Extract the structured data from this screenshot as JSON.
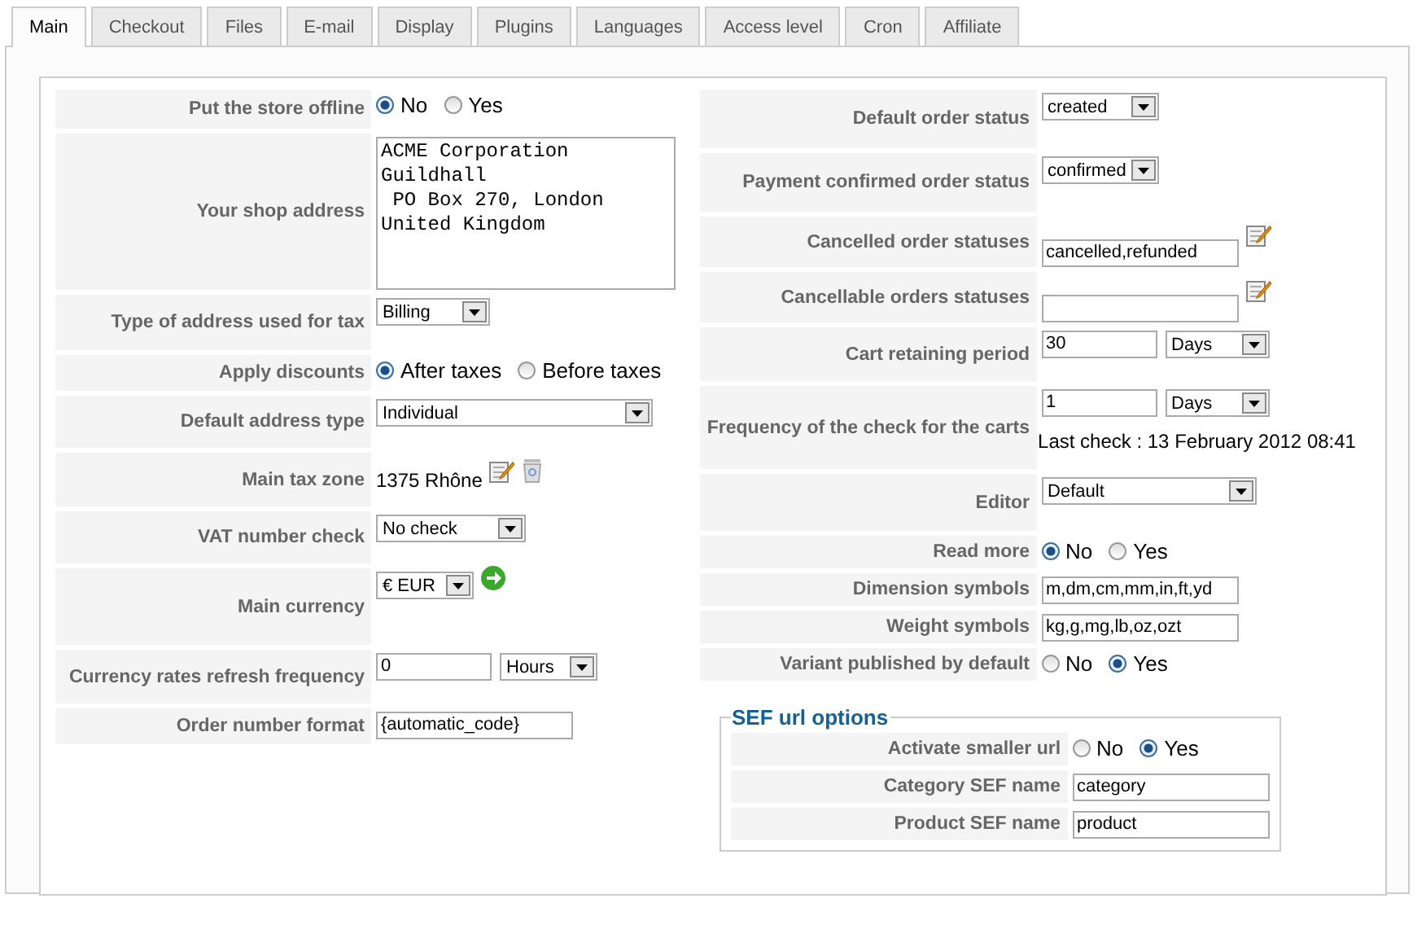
{
  "tabs": [
    {
      "label": "Main",
      "selected": true
    },
    {
      "label": "Checkout",
      "selected": false
    },
    {
      "label": "Files",
      "selected": false
    },
    {
      "label": "E-mail",
      "selected": false
    },
    {
      "label": "Display",
      "selected": false
    },
    {
      "label": "Plugins",
      "selected": false
    },
    {
      "label": "Languages",
      "selected": false
    },
    {
      "label": "Access level",
      "selected": false
    },
    {
      "label": "Cron",
      "selected": false
    },
    {
      "label": "Affiliate",
      "selected": false
    }
  ],
  "left_rows": [
    {
      "label": "Put the store offline",
      "kind": "radio",
      "options": [
        {
          "label": "No",
          "selected": true
        },
        {
          "label": "Yes",
          "selected": false
        }
      ]
    },
    {
      "label": "Your shop address",
      "kind": "textarea",
      "value": "ACME Corporation\nGuildhall\n PO Box 270, London\nUnited Kingdom"
    },
    {
      "label": "Type of address used for tax",
      "kind": "select",
      "value": "Billing"
    },
    {
      "label": "Apply discounts",
      "kind": "radio",
      "options": [
        {
          "label": "After taxes",
          "selected": true
        },
        {
          "label": "Before taxes",
          "selected": false
        }
      ]
    },
    {
      "label": "Default address type",
      "kind": "select",
      "value": "Individual"
    },
    {
      "label": "Main tax zone",
      "kind": "zone",
      "value": "1375 Rhône"
    },
    {
      "label": "VAT number check",
      "kind": "select",
      "value": "No check"
    },
    {
      "label": "Main currency",
      "kind": "select_refresh",
      "value": "€ EUR"
    },
    {
      "label": "Currency rates refresh frequency",
      "kind": "text_select",
      "value": "0",
      "unit": "Hours"
    },
    {
      "label": "Order number format",
      "kind": "text",
      "value": "{automatic_code}"
    }
  ],
  "right_rows": [
    {
      "label": "Default order status",
      "kind": "select",
      "value": "created"
    },
    {
      "label": "Payment confirmed order status",
      "kind": "select",
      "value": "confirmed"
    },
    {
      "label": "Cancelled order statuses",
      "kind": "text_edit",
      "value": "cancelled,refunded"
    },
    {
      "label": "Cancellable orders statuses",
      "kind": "text_edit"
    },
    {
      "label": "Cart retaining period",
      "kind": "text_select",
      "value": "30",
      "unit": "Days"
    },
    {
      "label": "Frequency of the check for the carts",
      "kind": "text_select",
      "value": "1",
      "unit": "Days",
      "note": "Last check : 13 February 2012 08:41"
    },
    {
      "label": "Editor",
      "kind": "select",
      "value": "Default"
    },
    {
      "label": "Read more",
      "kind": "radio",
      "options": [
        {
          "label": "No",
          "selected": true
        },
        {
          "label": "Yes",
          "selected": false
        }
      ]
    },
    {
      "label": "Dimension symbols",
      "kind": "text",
      "value": "m,dm,cm,mm,in,ft,yd"
    },
    {
      "label": "Weight symbols",
      "kind": "text",
      "value": "kg,g,mg,lb,oz,ozt"
    },
    {
      "label": "Variant published by default",
      "kind": "radio",
      "options": [
        {
          "label": "No",
          "selected": false
        },
        {
          "label": "Yes",
          "selected": true
        }
      ]
    }
  ],
  "sef": {
    "legend": "SEF url options",
    "rows": [
      {
        "label": "Activate smaller url",
        "kind": "radio",
        "options": [
          {
            "label": "No",
            "selected": false
          },
          {
            "label": "Yes",
            "selected": true
          }
        ]
      },
      {
        "label": "Category SEF name",
        "kind": "text",
        "value": "category"
      },
      {
        "label": "Product SEF name",
        "kind": "text",
        "value": "product"
      }
    ]
  }
}
